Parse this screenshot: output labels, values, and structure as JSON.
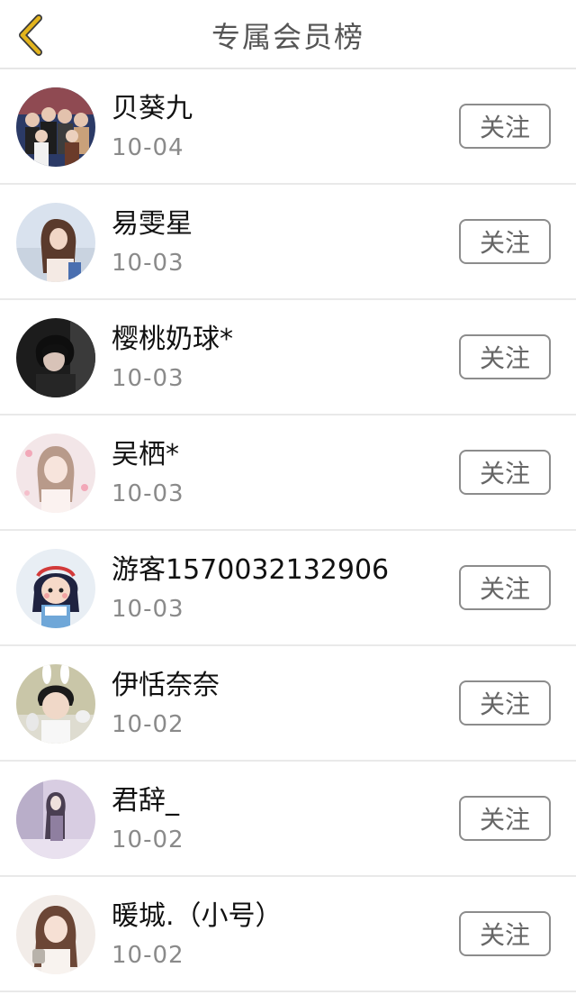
{
  "header": {
    "title": "专属会员榜",
    "back_icon": "chevron-left-icon",
    "back_color": "#e3b41d"
  },
  "members": [
    {
      "name": "贝葵九",
      "date": "10-04",
      "follow_label": "关注"
    },
    {
      "name": "易雯星",
      "date": "10-03",
      "follow_label": "关注"
    },
    {
      "name": "樱桃奶球*",
      "date": "10-03",
      "follow_label": "关注"
    },
    {
      "name": "吴栖*",
      "date": "10-03",
      "follow_label": "关注"
    },
    {
      "name": "游客1570032132906",
      "date": "10-03",
      "follow_label": "关注"
    },
    {
      "name": "伊恬奈奈",
      "date": "10-02",
      "follow_label": "关注"
    },
    {
      "name": "君辞_",
      "date": "10-02",
      "follow_label": "关注"
    },
    {
      "name": "暖城.（小号）",
      "date": "10-02",
      "follow_label": "关注"
    }
  ]
}
